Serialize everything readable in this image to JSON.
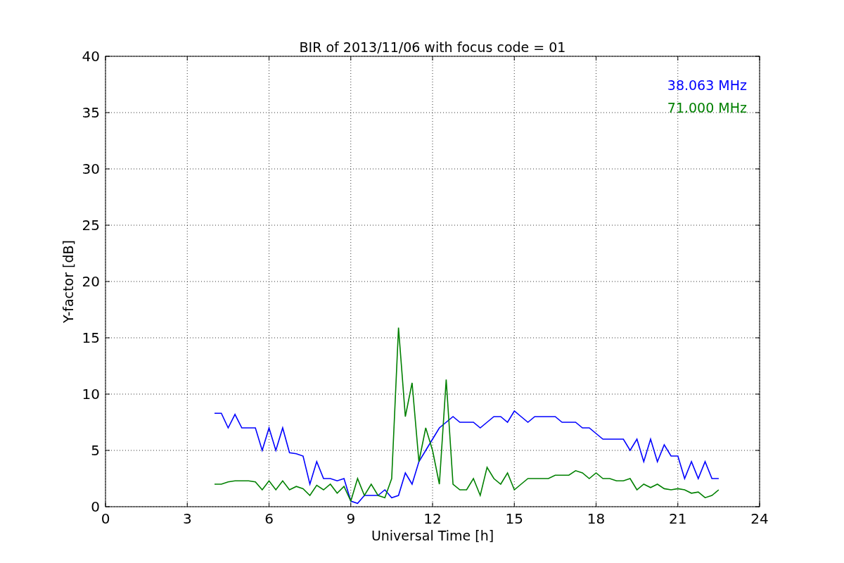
{
  "chart_data": {
    "type": "line",
    "title": "BIR of 2013/11/06 with focus code = 01",
    "xlabel": "Universal Time [h]",
    "ylabel": "Y-factor [dB]",
    "x": [
      4,
      4.25,
      4.5,
      4.75,
      5,
      5.25,
      5.5,
      5.75,
      6,
      6.25,
      6.5,
      6.75,
      7,
      7.25,
      7.5,
      7.75,
      8,
      8.25,
      8.5,
      8.75,
      9,
      9.25,
      9.5,
      9.75,
      10,
      10.25,
      10.5,
      10.75,
      11,
      11.25,
      11.5,
      11.75,
      12,
      12.25,
      12.5,
      12.75,
      13,
      13.25,
      13.5,
      13.75,
      14,
      14.25,
      14.5,
      14.75,
      15,
      15.25,
      15.5,
      15.75,
      16,
      16.25,
      16.5,
      16.75,
      17,
      17.25,
      17.5,
      17.75,
      18,
      18.25,
      18.5,
      18.75,
      19,
      19.25,
      19.5,
      19.75,
      20,
      20.25,
      20.5,
      20.75,
      21,
      21.25,
      21.5,
      21.75,
      22,
      22.25,
      22.5
    ],
    "series": [
      {
        "name": "38.063 MHz",
        "color": "#0000ff",
        "values": [
          8.3,
          8.3,
          7,
          8.2,
          7,
          7,
          7,
          5,
          7,
          5,
          7,
          4.8,
          4.7,
          4.5,
          2,
          4,
          2.5,
          2.5,
          2.3,
          2.5,
          0.5,
          0.3,
          1,
          1,
          1,
          1.5,
          0.8,
          1,
          3,
          2,
          4,
          5,
          6,
          7,
          7.5,
          8,
          7.5,
          7.5,
          7.5,
          7,
          7.5,
          8,
          8,
          7.5,
          8.5,
          8,
          7.5,
          8,
          8,
          8,
          8,
          7.5,
          7.5,
          7.5,
          7,
          7,
          6.5,
          6,
          6,
          6,
          6,
          5,
          6,
          4,
          6,
          4,
          5.5,
          4.5,
          4.5,
          2.5,
          4,
          2.5,
          4,
          2.5,
          2.5
        ]
      },
      {
        "name": "71.000 MHz",
        "color": "#008000",
        "values": [
          2,
          2,
          2.2,
          2.3,
          2.3,
          2.3,
          2.2,
          1.5,
          2.3,
          1.5,
          2.3,
          1.5,
          1.8,
          1.6,
          1,
          1.9,
          1.5,
          2,
          1.2,
          1.8,
          0.5,
          2.5,
          1,
          2,
          1,
          0.8,
          2.5,
          15.9,
          8,
          11,
          4,
          7,
          5,
          2,
          11.3,
          2,
          1.5,
          1.5,
          2.5,
          1,
          3.5,
          2.5,
          2,
          3,
          1.5,
          2,
          2.5,
          2.5,
          2.5,
          2.5,
          2.8,
          2.8,
          2.8,
          3.2,
          3,
          2.5,
          3,
          2.5,
          2.5,
          2.3,
          2.3,
          2.5,
          1.5,
          2,
          1.7,
          2,
          1.6,
          1.5,
          1.6,
          1.5,
          1.2,
          1.3,
          0.8,
          1,
          1.5
        ]
      }
    ],
    "grid": true,
    "xlim": [
      0,
      24
    ],
    "ylim": [
      0,
      40
    ],
    "xticks": [
      0,
      3,
      6,
      9,
      12,
      15,
      18,
      21,
      24
    ],
    "yticks": [
      0,
      5,
      10,
      15,
      20,
      25,
      30,
      35,
      40
    ]
  }
}
